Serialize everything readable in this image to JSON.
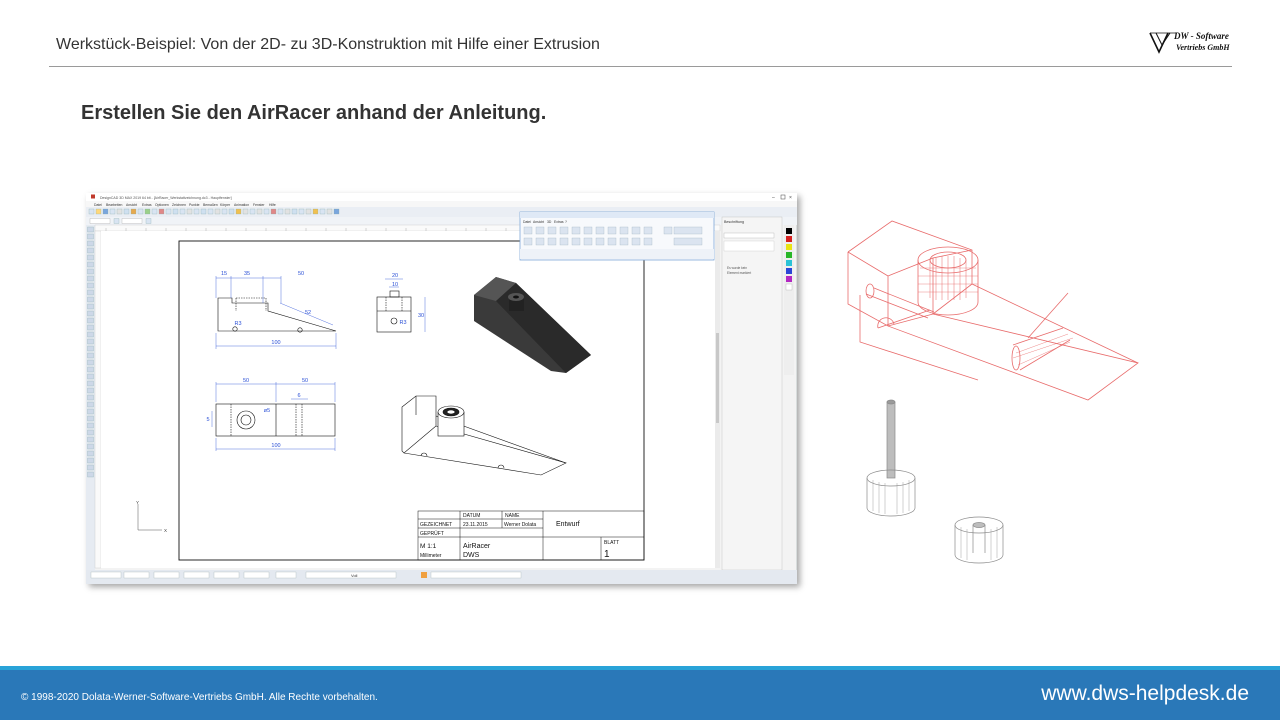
{
  "header": {
    "title": "Werkstück-Beispiel: Von der 2D- zu 3D-Konstruktion mit Hilfe einer Extrusion",
    "logo": {
      "line1": "DW - Software",
      "line2": "Vertriebs GmbH"
    }
  },
  "slide": {
    "heading": "Erstellen Sie den AirRacer anhand der Anleitung."
  },
  "cad_window": {
    "menu": [
      "Datei",
      "Bearbeiten",
      "Ansicht",
      "Extras",
      "Optionen",
      "Zeichnen",
      "Punkte",
      "Bemaßen",
      "Körper",
      "Animation",
      "Fenster",
      "Hilfe"
    ],
    "floating_toolbar_menu": [
      "Datei",
      "Ansicht",
      "3D",
      "Extras",
      "?"
    ],
    "side_panel": {
      "title": "Beschriftung",
      "line1": "Es wurde kein",
      "line2": "Element markiert"
    },
    "status": {
      "line_style": "Voll"
    },
    "drawing": {
      "dims_front": [
        "15",
        "35",
        "50",
        "100"
      ],
      "dim_slope": "52",
      "dims_side": [
        "20",
        "10",
        "30"
      ],
      "dim_side_radius": "R3",
      "dim_radius": "R3",
      "dims_top": [
        "50",
        "50",
        "100"
      ],
      "dim_small": "6",
      "dim_top_left": "5",
      "dim_diameter": "ø5",
      "axis_x": "X",
      "axis_y": "Y"
    },
    "title_block": {
      "col_date": "DATUM",
      "col_name": "NAME",
      "drawn_label": "GEZEICHNET",
      "drawn_date": "23.11.2015",
      "drawn_name": "Werner Dolata",
      "checked_label": "GEPRÜFT",
      "status": "Entwurf",
      "scale": "M 1:1",
      "unit": "Millimeter",
      "part_name": "AirRacer",
      "company": "DWS",
      "sheet_label": "BLATT",
      "sheet_number": "1"
    }
  },
  "footer": {
    "copyright": "© 1998-2020 Dolata-Werner-Software-Vertriebs GmbH. Alle Rechte vorbehalten.",
    "url": "www.dws-helpdesk.de"
  },
  "colors": {
    "accent_blue": "#2a78b8",
    "footer_stripe": "#29a3d8",
    "wireframe_red": "#e86b6b"
  }
}
